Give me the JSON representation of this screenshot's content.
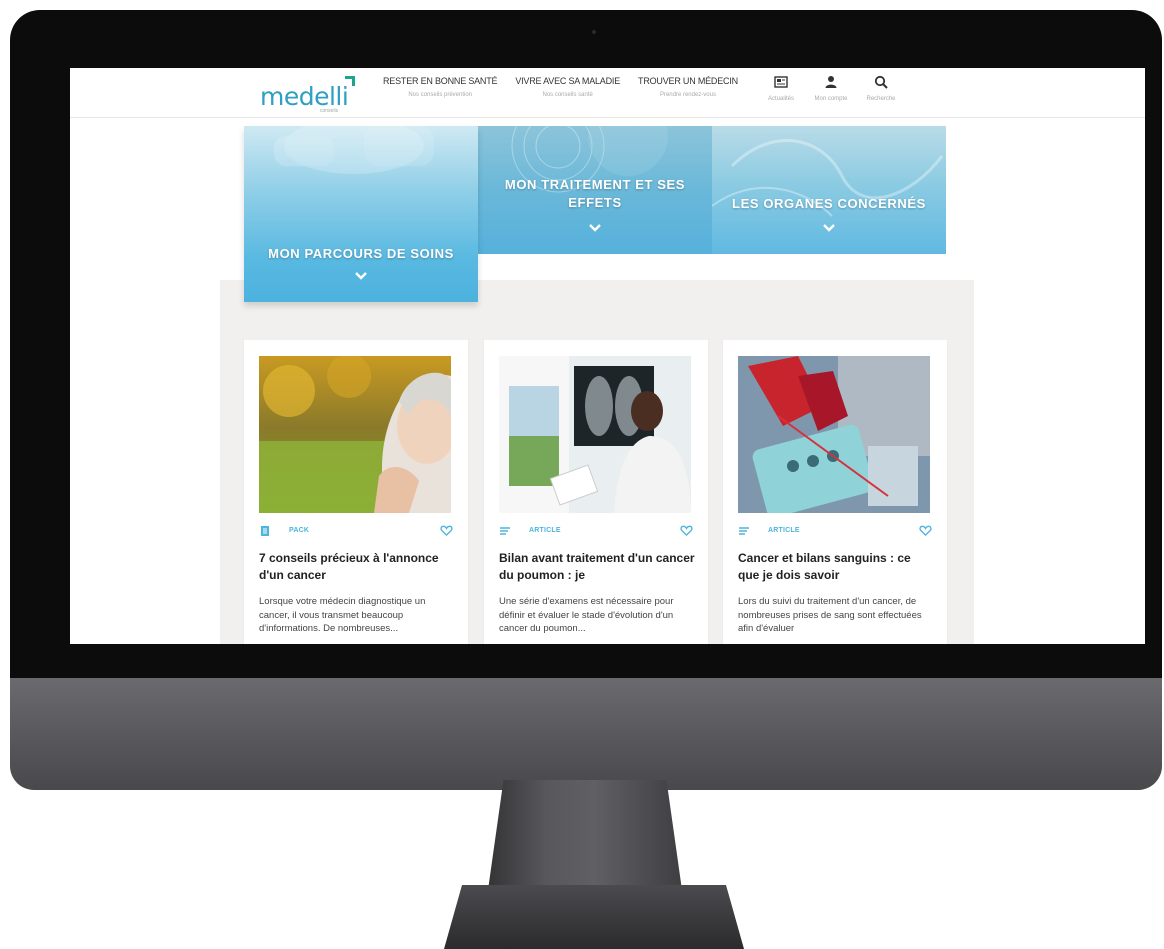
{
  "header": {
    "logo": {
      "name": "medelli",
      "tagline": "conseils"
    },
    "nav": [
      {
        "label": "RESTER EN BONNE SANTÉ",
        "sub": "Nos conseils prévention"
      },
      {
        "label": "VIVRE AVEC SA MALADIE",
        "sub": "Nos conseils santé"
      },
      {
        "label": "TROUVER UN MÉDECIN",
        "sub": "Prendre rendez-vous"
      }
    ],
    "tools": [
      {
        "label": "Actualités",
        "icon": "newspaper-icon"
      },
      {
        "label": "Mon compte",
        "icon": "user-icon"
      },
      {
        "label": "Recherche",
        "icon": "search-icon"
      }
    ]
  },
  "hero": {
    "tiles": [
      {
        "label": "MON PARCOURS DE SOINS"
      },
      {
        "label": "MON TRAITEMENT ET SES EFFETS"
      },
      {
        "label": "LES ORGANES CONCERNÉS"
      }
    ]
  },
  "cards": [
    {
      "type": "PACK",
      "title": "7 conseils précieux à l'annonce d'un cancer",
      "excerpt": "Lorsque votre médecin diagnostique un cancer, il vous transmet beaucoup d'informations. De nombreuses..."
    },
    {
      "type": "ARTICLE",
      "title": "Bilan avant traitement d'un cancer du poumon : je",
      "excerpt": "Une série d'examens est nécessaire pour définir et évaluer le stade d'évolution d'un cancer du poumon..."
    },
    {
      "type": "ARTICLE",
      "title": "Cancer et bilans sanguins : ce que je dois savoir",
      "excerpt": "Lors du suivi du traitement d'un cancer, de nombreuses prises de sang sont effectuées afin d'évaluer"
    }
  ],
  "colors": {
    "brand": "#2f9fc3",
    "accent": "#4db4db",
    "hero_blue": "#56b1dc",
    "band_bg": "#f2f0ef"
  }
}
